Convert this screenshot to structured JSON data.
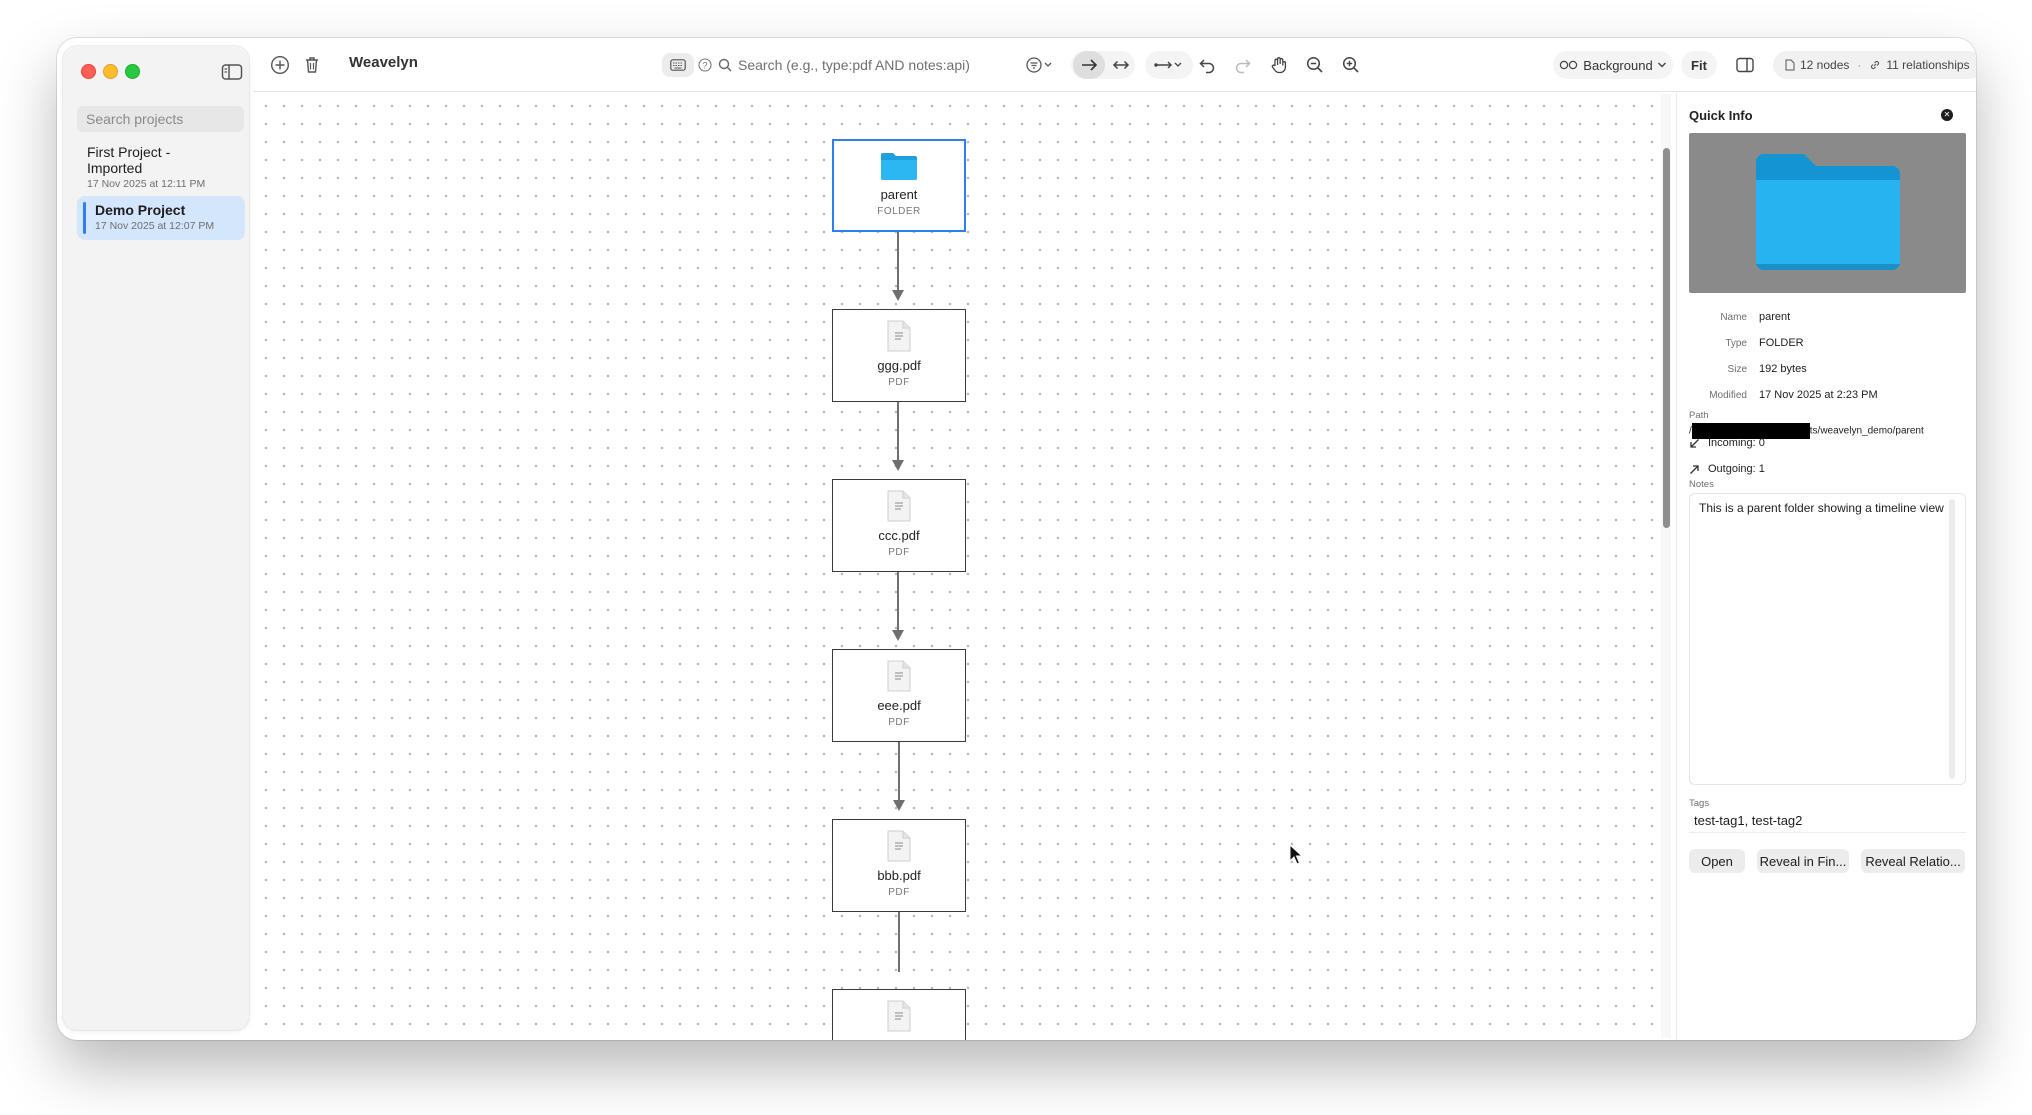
{
  "app": {
    "title": "Weavelyn"
  },
  "sidebar": {
    "search_placeholder": "Search projects",
    "projects": [
      {
        "name": "First Project - Imported",
        "date": "17 Nov 2025 at 12:11 PM"
      },
      {
        "name": "Demo Project",
        "date": "17 Nov 2025 at 12:07 PM",
        "selected": true
      }
    ]
  },
  "toolbar": {
    "search_placeholder": "Search (e.g., type:pdf AND notes:api)",
    "background_label": "Background",
    "fit_label": "Fit",
    "nodes_count": "12 nodes",
    "relationships_count": "11 relationships",
    "separator": "·"
  },
  "canvas": {
    "nodes": [
      {
        "name": "parent",
        "type": "FOLDER",
        "selected": true
      },
      {
        "name": "ggg.pdf",
        "type": "PDF"
      },
      {
        "name": "ccc.pdf",
        "type": "PDF"
      },
      {
        "name": "eee.pdf",
        "type": "PDF"
      },
      {
        "name": "bbb.pdf",
        "type": "PDF"
      }
    ]
  },
  "inspector": {
    "title": "Quick Info",
    "fields": {
      "name_label": "Name",
      "name_value": "parent",
      "type_label": "Type",
      "type_value": "FOLDER",
      "size_label": "Size",
      "size_value": "192 bytes",
      "modified_label": "Modified",
      "modified_value": "17 Nov 2025 at 2:23 PM"
    },
    "path_label": "Path",
    "path_prefix": "/",
    "path_suffix": "ts/weavelyn_demo/parent",
    "incoming": "Incoming: 0",
    "outgoing": "Outgoing: 1",
    "notes_label": "Notes",
    "notes_value": "This is a parent folder showing a timeline view",
    "tags_label": "Tags",
    "tags_value": "test-tag1, test-tag2",
    "buttons": {
      "open": "Open",
      "reveal_finder": "Reveal in Fin...",
      "reveal_relations": "Reveal Relatio..."
    }
  },
  "colors": {
    "accent": "#2f7ff0",
    "selected_bg": "#d4e6fb",
    "folder": "#29aef0"
  }
}
